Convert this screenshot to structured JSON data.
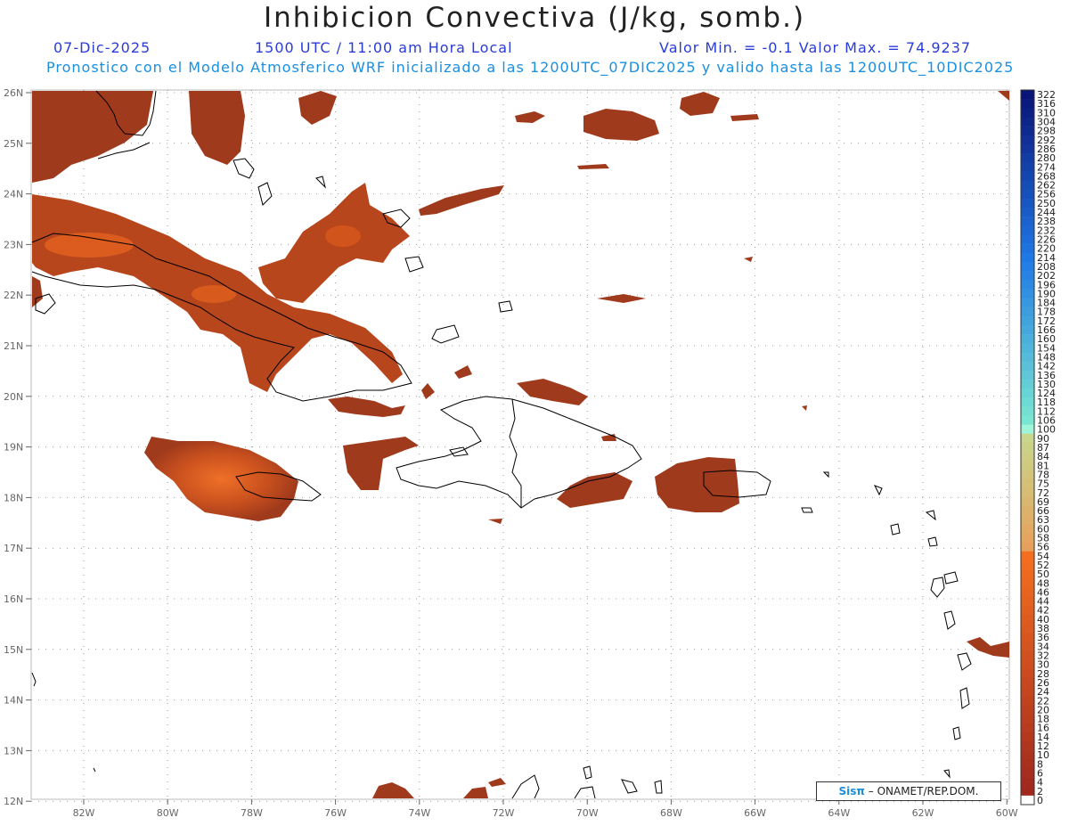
{
  "header": {
    "title": "Inhibicion Convectiva (J/kg, somb.)",
    "date": "07-Dic-2025",
    "time": "1500 UTC / 11:00 am Hora Local",
    "minmax": "Valor Min. = -0.1  Valor Max. = 74.9237",
    "model_info": "Pronostico con el Modelo Atmosferico WRF inicializado a las 1200UTC_07DIC2025 y valido hasta las  1200UTC_10DIC2025"
  },
  "map": {
    "lat_labels": [
      "26N",
      "25N",
      "24N",
      "23N",
      "22N",
      "21N",
      "20N",
      "19N",
      "18N",
      "17N",
      "16N",
      "15N",
      "14N",
      "13N",
      "12N"
    ],
    "lon_labels": [
      "82W",
      "80W",
      "78W",
      "76W",
      "74W",
      "72W",
      "70W",
      "68W",
      "66W",
      "64W",
      "62W",
      "60W"
    ],
    "fill_color": "#a03a1c",
    "hot_color": "#f0641e",
    "coast_color": "#000000"
  },
  "colorbar": {
    "labels": [
      "322",
      "316",
      "310",
      "304",
      "298",
      "292",
      "286",
      "280",
      "274",
      "268",
      "262",
      "256",
      "250",
      "244",
      "238",
      "232",
      "226",
      "220",
      "214",
      "208",
      "202",
      "196",
      "190",
      "184",
      "178",
      "172",
      "166",
      "160",
      "154",
      "148",
      "142",
      "136",
      "130",
      "124",
      "118",
      "112",
      "106",
      "100",
      "90",
      "87",
      "84",
      "81",
      "78",
      "75",
      "72",
      "69",
      "66",
      "63",
      "60",
      "58",
      "56",
      "54",
      "52",
      "50",
      "48",
      "46",
      "44",
      "42",
      "40",
      "38",
      "36",
      "34",
      "32",
      "30",
      "28",
      "26",
      "24",
      "22",
      "20",
      "18",
      "16",
      "14",
      "12",
      "10",
      "8",
      "6",
      "4",
      "2",
      "0"
    ]
  },
  "credit": {
    "logo": "Sisπ",
    "org": "– ONAMET/REP.DOM."
  }
}
